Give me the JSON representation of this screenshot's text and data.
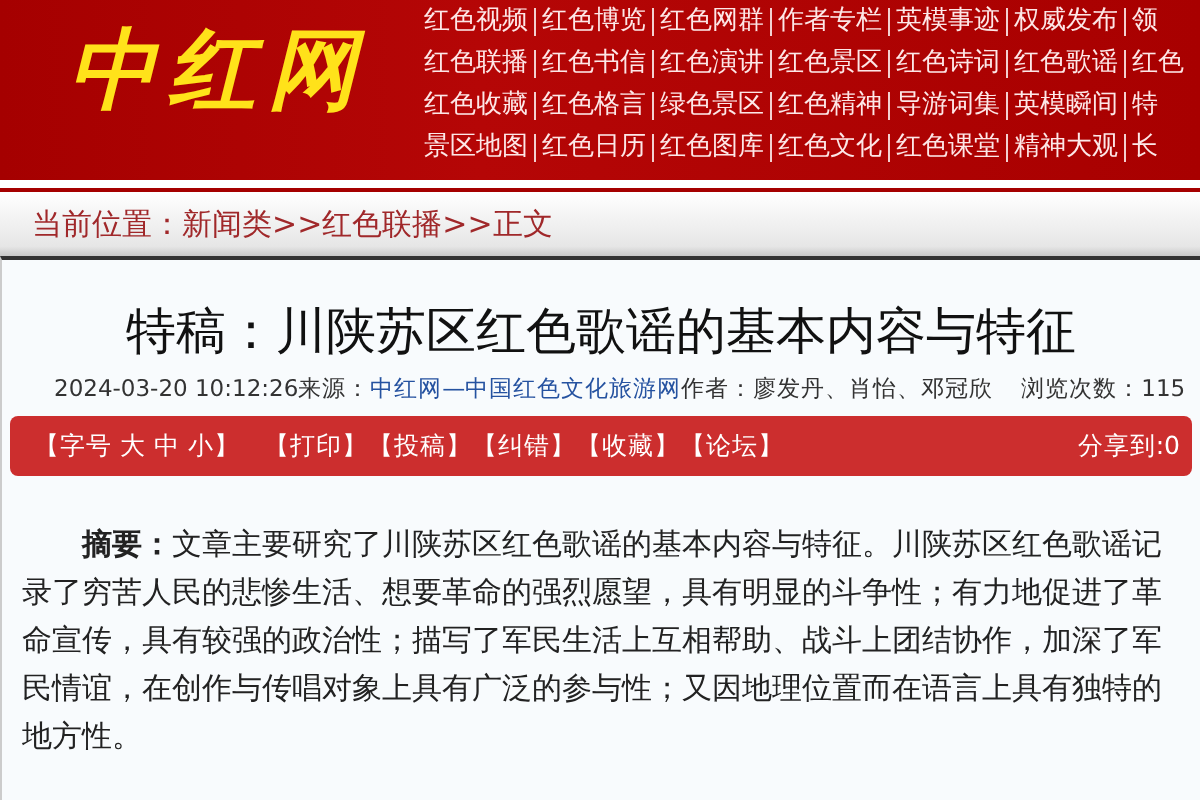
{
  "header": {
    "logo": "中红网",
    "nav_rows": [
      [
        "红色视频",
        "红色博览",
        "红色网群",
        "作者专栏",
        "英模事迹",
        "权威发布",
        "领"
      ],
      [
        "红色联播",
        "红色书信",
        "红色演讲",
        "红色景区",
        "红色诗词",
        "红色歌谣",
        "红色"
      ],
      [
        "红色收藏",
        "红色格言",
        "绿色景区",
        "红色精神",
        "导游词集",
        "英模瞬间",
        "特"
      ],
      [
        "景区地图",
        "红色日历",
        "红色图库",
        "红色文化",
        "红色课堂",
        "精神大观",
        "长"
      ]
    ]
  },
  "breadcrumb": "当前位置：新闻类>>红色联播>>正文",
  "article": {
    "title": "特稿：川陕苏区红色歌谣的基本内容与特征",
    "date": "2024-03-20 10:12:26",
    "source_label": "来源：",
    "source": "中红网—中国红色文化旅游网",
    "author": "作者：廖发丹、肖怡、邓冠欣",
    "views": "浏览次数：115",
    "toolbar": [
      "【字号 大 中 小】",
      "【打印】",
      "【投稿】",
      "【纠错】",
      "【收藏】",
      "【论坛】"
    ],
    "share": "分享到:0",
    "abstract": "**摘要：**文章主要研究了川陕苏区红色歌谣的基本内容与特征。川陕苏区红色歌谣记录了穷苦人民的悲惨生活、想要革命的强烈愿望，具有明显的斗争性；有力地促进了革命宣传，具有较强的政治性；描写了军民生活上互相帮助、战斗上团结协作，加深了军民情谊，在创作与传唱对象上具有广泛的参与性；又因地理位置而在语言上具有独特的地方性。"
  }
}
